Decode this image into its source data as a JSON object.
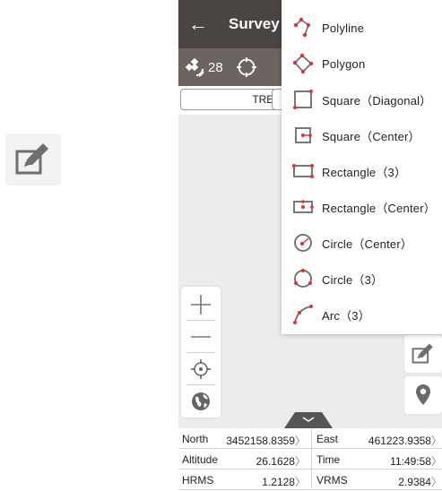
{
  "app": {
    "title": "Survey",
    "back_icon": "arrow-left-icon"
  },
  "status": {
    "satellite_count": "28",
    "satellite_icon": "satellite-icon",
    "target_icon": "crosshair-icon"
  },
  "info": {
    "point_name": "TRE3"
  },
  "menu": {
    "items": [
      {
        "label": "Polyline",
        "icon": "polyline-icon"
      },
      {
        "label": "Polygon",
        "icon": "polygon-icon"
      },
      {
        "label": "Square（Diagonal）",
        "icon": "square-diagonal-icon"
      },
      {
        "label": "Square（Center）",
        "icon": "square-center-icon"
      },
      {
        "label": "Rectangle（3）",
        "icon": "rectangle-3-icon"
      },
      {
        "label": "Rectangle（Center）",
        "icon": "rectangle-center-icon"
      },
      {
        "label": "Circle（Center）",
        "icon": "circle-center-icon"
      },
      {
        "label": "Circle（3）",
        "icon": "circle-3-icon"
      },
      {
        "label": "Arc（3）",
        "icon": "arc-3-icon"
      }
    ]
  },
  "map_tools": {
    "zoom_in_icon": "plus-icon",
    "zoom_out_icon": "minus-icon",
    "locate_icon": "locate-icon",
    "layers_icon": "globe-icon",
    "edit_icon": "edit-icon",
    "pin_icon": "map-pin-icon",
    "handle_icon": "chevron-down-icon"
  },
  "table": {
    "rows": [
      [
        {
          "label": "North",
          "value": "3452158.8359"
        },
        {
          "label": "East",
          "value": "461223.9358"
        }
      ],
      [
        {
          "label": "Altitude",
          "value": "26.1628"
        },
        {
          "label": "Time",
          "value": "11:49:58"
        }
      ],
      [
        {
          "label": "HRMS",
          "value": "1.2128"
        },
        {
          "label": "VRMS",
          "value": "2.9384"
        }
      ]
    ]
  },
  "colors": {
    "appbar": "#4a4543",
    "statusbar": "#6b6461",
    "accent_red": "#e0303c",
    "icon_gray": "#7a7a7a"
  }
}
